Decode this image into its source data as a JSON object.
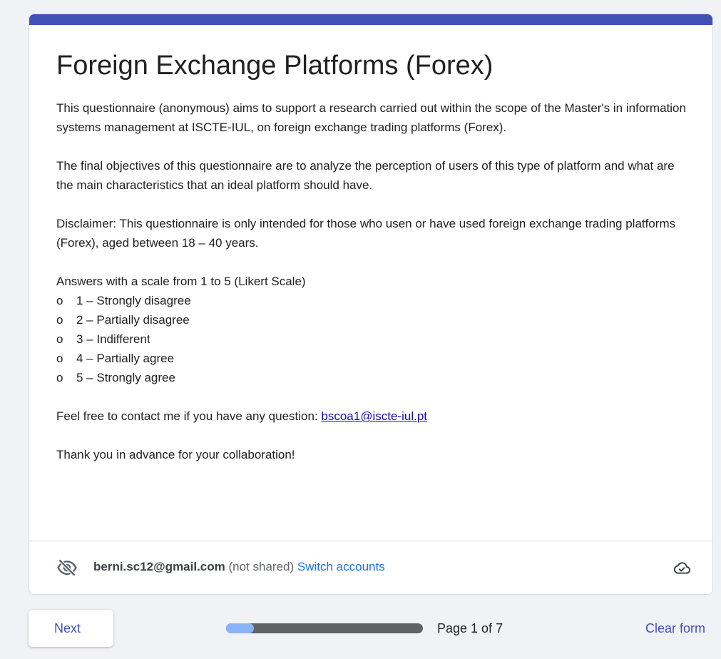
{
  "form": {
    "title": "Foreign Exchange Platforms (Forex)",
    "description": {
      "intro": "This questionnaire (anonymous) aims to support a research carried out within the scope of the Master's in information systems management at ISCTE-IUL, on foreign exchange trading platforms (Forex).",
      "objectives": "The final objectives of this questionnaire are to analyze the perception of users of this type of platform and what are the main characteristics that an ideal platform should have.",
      "disclaimer": "Disclaimer: This questionnaire is only intended for those who usen or have used foreign exchange trading platforms (Forex), aged between 18 – 40 years.",
      "scale_heading": "Answers with a scale from 1 to 5 (Likert Scale)",
      "scale_bullet": "o",
      "scale_items": [
        "1 – Strongly disagree",
        "2 – Partially disagree",
        "3 – Indifferent",
        "4 – Partially agree",
        "5 – Strongly agree"
      ],
      "contact_text": "Feel free to contact me if you have any question: ",
      "contact_email": "bscoa1@iscte-iul.pt",
      "thanks": "Thank you in advance for your collaboration!"
    },
    "accent_color": "#4051b5"
  },
  "account": {
    "email": "berni.sc12@gmail.com",
    "not_shared": " (not shared) ",
    "switch_label": "Switch accounts",
    "privacy_icon": "eye-off-icon",
    "save_icon": "cloud-check-icon"
  },
  "footer": {
    "next_label": "Next",
    "progress_fraction": 0.143,
    "page_indicator": "Page 1 of 7",
    "clear_label": "Clear form"
  }
}
